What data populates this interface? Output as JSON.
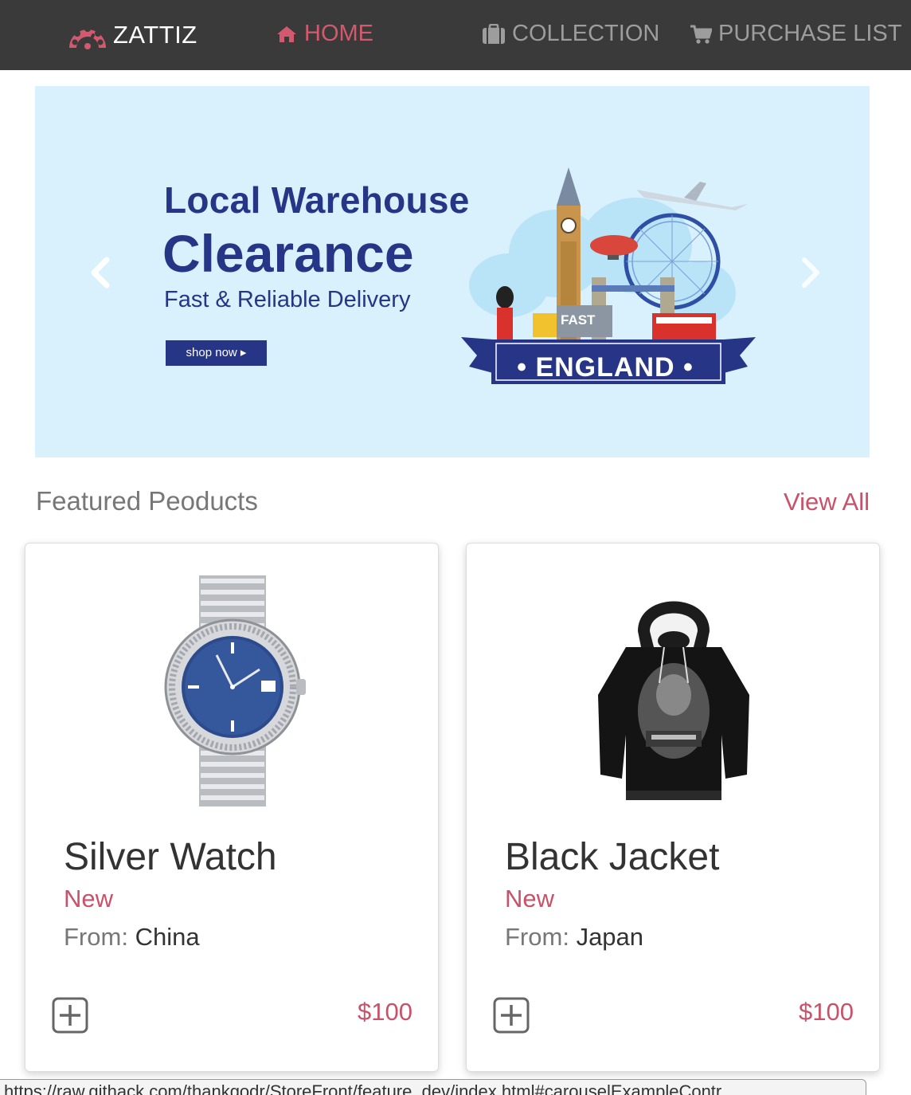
{
  "navbar": {
    "brand": "ZATTIZ",
    "brand_icon": "dashboard-gauge-icon",
    "links": [
      {
        "label": "HOME",
        "icon": "home-icon",
        "active": true
      },
      {
        "label": "COLLECTION",
        "icon": "briefcase-icon",
        "active": false
      },
      {
        "label": "PURCHASE LIST",
        "icon": "shopping-cart-icon",
        "active": false
      }
    ],
    "colors": {
      "background": "#3a3a3a",
      "active": "#d35a6e",
      "inactive": "#9d9d9d"
    }
  },
  "carousel": {
    "banner": {
      "line1": "Local  Warehouse",
      "line2": "Clearance",
      "line3": "Fast & Reliable Delivery",
      "button": "shop now ▸",
      "scene_label": "• ENGLAND •",
      "truck_label": "FAST"
    },
    "prev_icon": "chevron-left-icon",
    "next_icon": "chevron-right-icon",
    "background": "#d9f1fd"
  },
  "featured": {
    "title": "Featured Peoducts",
    "view_all": "View All"
  },
  "products": [
    {
      "name": "Silver Watch",
      "condition": "New",
      "origin_label": "From:",
      "origin": "China",
      "price": "$100",
      "image": "silver-watch-image"
    },
    {
      "name": "Black Jacket",
      "condition": "New",
      "origin_label": "From:",
      "origin": "Japan",
      "price": "$100",
      "image": "black-hoodie-image"
    }
  ],
  "status_bar": {
    "url": "https://raw.githack.com/thankgodr/StoreFront/feature_dev/index.html#carouselExampleContr"
  },
  "accent_color": "#c9526a"
}
